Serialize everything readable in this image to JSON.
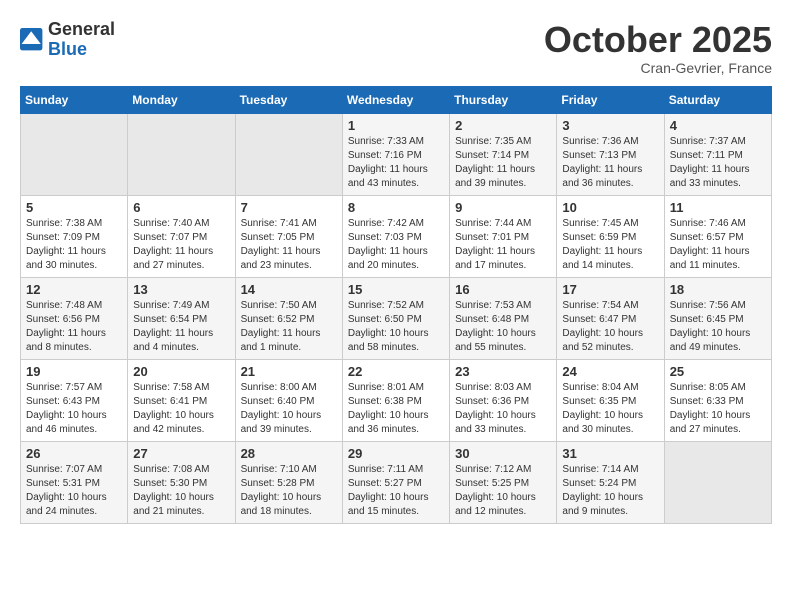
{
  "logo": {
    "general": "General",
    "blue": "Blue"
  },
  "header": {
    "month": "October 2025",
    "location": "Cran-Gevrier, France"
  },
  "weekdays": [
    "Sunday",
    "Monday",
    "Tuesday",
    "Wednesday",
    "Thursday",
    "Friday",
    "Saturday"
  ],
  "weeks": [
    [
      {
        "day": "",
        "info": ""
      },
      {
        "day": "",
        "info": ""
      },
      {
        "day": "",
        "info": ""
      },
      {
        "day": "1",
        "info": "Sunrise: 7:33 AM\nSunset: 7:16 PM\nDaylight: 11 hours and 43 minutes."
      },
      {
        "day": "2",
        "info": "Sunrise: 7:35 AM\nSunset: 7:14 PM\nDaylight: 11 hours and 39 minutes."
      },
      {
        "day": "3",
        "info": "Sunrise: 7:36 AM\nSunset: 7:13 PM\nDaylight: 11 hours and 36 minutes."
      },
      {
        "day": "4",
        "info": "Sunrise: 7:37 AM\nSunset: 7:11 PM\nDaylight: 11 hours and 33 minutes."
      }
    ],
    [
      {
        "day": "5",
        "info": "Sunrise: 7:38 AM\nSunset: 7:09 PM\nDaylight: 11 hours and 30 minutes."
      },
      {
        "day": "6",
        "info": "Sunrise: 7:40 AM\nSunset: 7:07 PM\nDaylight: 11 hours and 27 minutes."
      },
      {
        "day": "7",
        "info": "Sunrise: 7:41 AM\nSunset: 7:05 PM\nDaylight: 11 hours and 23 minutes."
      },
      {
        "day": "8",
        "info": "Sunrise: 7:42 AM\nSunset: 7:03 PM\nDaylight: 11 hours and 20 minutes."
      },
      {
        "day": "9",
        "info": "Sunrise: 7:44 AM\nSunset: 7:01 PM\nDaylight: 11 hours and 17 minutes."
      },
      {
        "day": "10",
        "info": "Sunrise: 7:45 AM\nSunset: 6:59 PM\nDaylight: 11 hours and 14 minutes."
      },
      {
        "day": "11",
        "info": "Sunrise: 7:46 AM\nSunset: 6:57 PM\nDaylight: 11 hours and 11 minutes."
      }
    ],
    [
      {
        "day": "12",
        "info": "Sunrise: 7:48 AM\nSunset: 6:56 PM\nDaylight: 11 hours and 8 minutes."
      },
      {
        "day": "13",
        "info": "Sunrise: 7:49 AM\nSunset: 6:54 PM\nDaylight: 11 hours and 4 minutes."
      },
      {
        "day": "14",
        "info": "Sunrise: 7:50 AM\nSunset: 6:52 PM\nDaylight: 11 hours and 1 minute."
      },
      {
        "day": "15",
        "info": "Sunrise: 7:52 AM\nSunset: 6:50 PM\nDaylight: 10 hours and 58 minutes."
      },
      {
        "day": "16",
        "info": "Sunrise: 7:53 AM\nSunset: 6:48 PM\nDaylight: 10 hours and 55 minutes."
      },
      {
        "day": "17",
        "info": "Sunrise: 7:54 AM\nSunset: 6:47 PM\nDaylight: 10 hours and 52 minutes."
      },
      {
        "day": "18",
        "info": "Sunrise: 7:56 AM\nSunset: 6:45 PM\nDaylight: 10 hours and 49 minutes."
      }
    ],
    [
      {
        "day": "19",
        "info": "Sunrise: 7:57 AM\nSunset: 6:43 PM\nDaylight: 10 hours and 46 minutes."
      },
      {
        "day": "20",
        "info": "Sunrise: 7:58 AM\nSunset: 6:41 PM\nDaylight: 10 hours and 42 minutes."
      },
      {
        "day": "21",
        "info": "Sunrise: 8:00 AM\nSunset: 6:40 PM\nDaylight: 10 hours and 39 minutes."
      },
      {
        "day": "22",
        "info": "Sunrise: 8:01 AM\nSunset: 6:38 PM\nDaylight: 10 hours and 36 minutes."
      },
      {
        "day": "23",
        "info": "Sunrise: 8:03 AM\nSunset: 6:36 PM\nDaylight: 10 hours and 33 minutes."
      },
      {
        "day": "24",
        "info": "Sunrise: 8:04 AM\nSunset: 6:35 PM\nDaylight: 10 hours and 30 minutes."
      },
      {
        "day": "25",
        "info": "Sunrise: 8:05 AM\nSunset: 6:33 PM\nDaylight: 10 hours and 27 minutes."
      }
    ],
    [
      {
        "day": "26",
        "info": "Sunrise: 7:07 AM\nSunset: 5:31 PM\nDaylight: 10 hours and 24 minutes."
      },
      {
        "day": "27",
        "info": "Sunrise: 7:08 AM\nSunset: 5:30 PM\nDaylight: 10 hours and 21 minutes."
      },
      {
        "day": "28",
        "info": "Sunrise: 7:10 AM\nSunset: 5:28 PM\nDaylight: 10 hours and 18 minutes."
      },
      {
        "day": "29",
        "info": "Sunrise: 7:11 AM\nSunset: 5:27 PM\nDaylight: 10 hours and 15 minutes."
      },
      {
        "day": "30",
        "info": "Sunrise: 7:12 AM\nSunset: 5:25 PM\nDaylight: 10 hours and 12 minutes."
      },
      {
        "day": "31",
        "info": "Sunrise: 7:14 AM\nSunset: 5:24 PM\nDaylight: 10 hours and 9 minutes."
      },
      {
        "day": "",
        "info": ""
      }
    ]
  ]
}
